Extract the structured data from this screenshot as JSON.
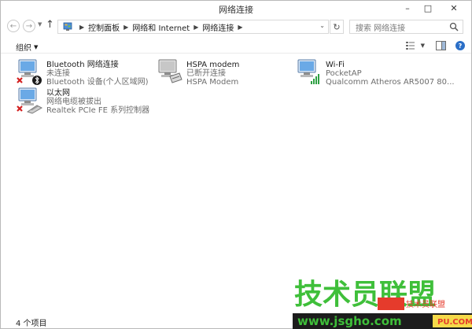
{
  "window": {
    "title": "网络连接",
    "controls": {
      "minimize": "–",
      "maximize": "□",
      "close": "✕"
    }
  },
  "nav": {
    "back_icon": "arrow-left-icon",
    "forward_icon": "arrow-right-icon",
    "recent_icon": "chevron-down-icon",
    "up_icon": "arrow-up-icon",
    "breadcrumbs": [
      "控制面板",
      "网络和 Internet",
      "网络连接"
    ],
    "search_placeholder": "搜索 网络连接"
  },
  "toolbar": {
    "organize_label": "组织"
  },
  "items": [
    {
      "name": "Bluetooth 网络连接",
      "status": "未连接",
      "device": "Bluetooth 设备(个人区域网)",
      "icon": "bluetooth-network-icon"
    },
    {
      "name": "HSPA modem",
      "status": "已断开连接",
      "device": "HSPA Modem",
      "icon": "modem-icon"
    },
    {
      "name": "Wi-Fi",
      "status": "PocketAP",
      "device": "Qualcomm Atheros AR5007 80...",
      "icon": "wifi-icon"
    },
    {
      "name": "以太网",
      "status": "网络电缆被拔出",
      "device": "Realtek PCIe FE 系列控制器",
      "icon": "ethernet-icon"
    }
  ],
  "statusbar": {
    "count": "4 个项目"
  },
  "watermark": {
    "main": "技术员联盟",
    "url": "www.jsgho.com",
    "small": "技术员联盟",
    "domain": "PU.COM"
  },
  "colors": {
    "accent": "#2b6fc7",
    "watermark_green": "#3fbf3a",
    "error_red": "#d32020",
    "wifi_green": "#2ea043"
  }
}
